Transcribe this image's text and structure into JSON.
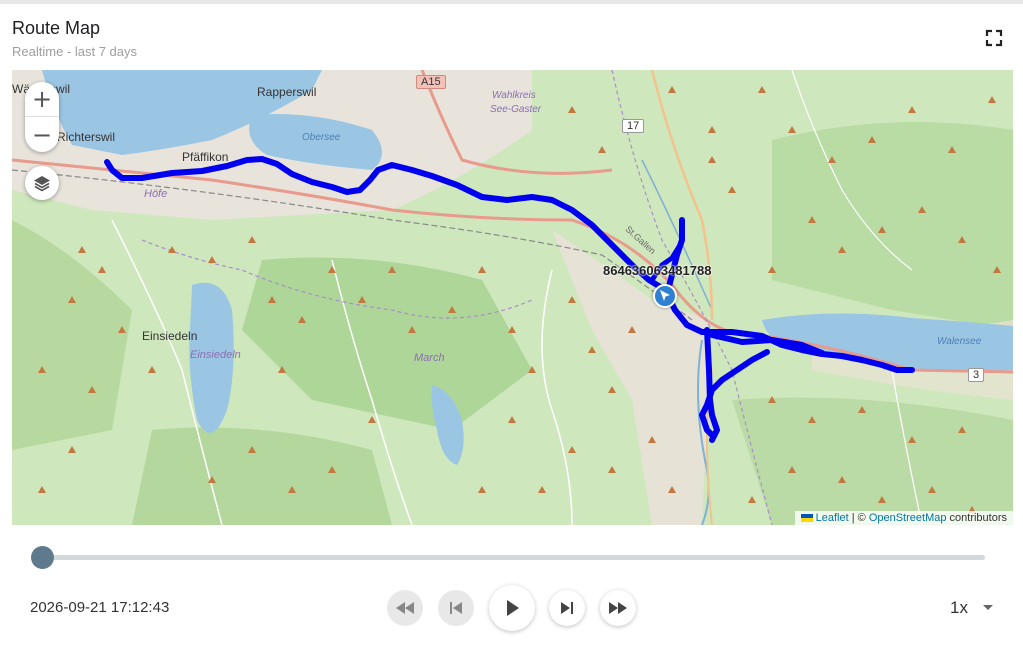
{
  "header": {
    "title": "Route Map",
    "subtitle": "Realtime - last 7 days"
  },
  "map": {
    "device_label": "864636063481788",
    "track_color": "#0000ee",
    "marker_color": "#2f80d1",
    "labels": {
      "rapperswil": "Rapperswil",
      "richterswil": "Richterswil",
      "pfaffikon": "Pfäffikon",
      "einsiedeln": "Einsiedeln",
      "einsiedeln_lake": "Einsiedeln",
      "hofe": "Höfe",
      "march": "March",
      "obersee": "Obersee",
      "walensee": "Walensee",
      "wahlkreis": "Wahlkreis",
      "see_gaster": "See-Gaster",
      "wadenswil": "Wädenswil",
      "stgallen": "St.Gallen"
    },
    "road_shields": {
      "a15": "A15",
      "r17": "17",
      "r3": "3"
    },
    "attribution": {
      "leaflet": "Leaflet",
      "separator": " | © ",
      "osm": "OpenStreetMap",
      "suffix": " contributors"
    }
  },
  "player": {
    "timestamp": "2026-09-21 17:12:43",
    "speed": "1x",
    "progress": 0
  }
}
